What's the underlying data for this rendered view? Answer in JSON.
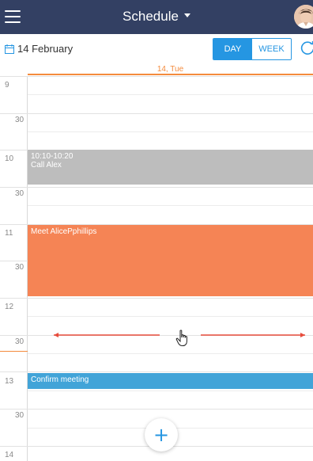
{
  "header": {
    "title": "Schedule"
  },
  "toolbar": {
    "date": "14 February",
    "view_day": "DAY",
    "view_week": "WEEK"
  },
  "day_header": "14, Tue",
  "timeline": {
    "h9": "9",
    "h9_30": "30",
    "h10": "10",
    "h10_30": "30",
    "h11": "11",
    "h11_30": "30",
    "h12": "12",
    "h12_30": "30",
    "h13": "13",
    "h13_30": "30",
    "h14": "14"
  },
  "events": [
    {
      "time": "10:10-10:20",
      "title": "Call Alex",
      "color": "#bdbdbd"
    },
    {
      "title": "Meet AlicePphillips",
      "color": "#f58455"
    },
    {
      "title": "Confirm meeting",
      "color": "#42a4d8"
    }
  ],
  "fab": {
    "label": "+"
  },
  "colors": {
    "header_bg": "#334063",
    "accent": "#2596e2",
    "today": "#f48b3d",
    "drag_indicator": "#e74c3c"
  },
  "icons": [
    "menu-icon",
    "caret-down-icon",
    "avatar",
    "calendar-icon",
    "refresh-icon",
    "left-arrow-icon",
    "right-arrow-icon",
    "hand-cursor-icon",
    "plus-icon"
  ]
}
